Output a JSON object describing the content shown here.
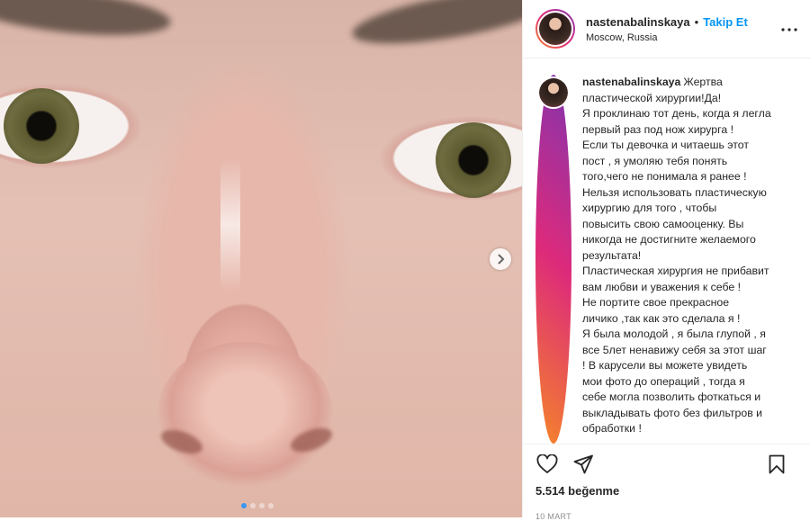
{
  "media": {
    "next_icon": "chevron-right-icon",
    "carousel_dots": 4,
    "active_dot": 0
  },
  "header": {
    "username": "nastenabalinskaya",
    "bullet": "•",
    "follow_label": "Takip Et",
    "location": "Moscow, Russia",
    "more_icon": "ellipsis-icon"
  },
  "caption": {
    "username": "nastenabalinskaya",
    "lines": [
      "Жертва",
      "пластической хирургии!Да!",
      "Я проклинаю тот день, когда я легла",
      "первый раз под нож хирурга !",
      "Если ты девочка и читаешь этот",
      "пост , я умоляю тебя понять",
      "того,чего не понимала я ранее !",
      "Нельзя использовать пластическую",
      "хирургию для того , чтобы",
      "повысить свою самооценку. Вы",
      "никогда не достигните желаемого",
      "результата!",
      "Пластическая хирургия не прибавит",
      "вам любви и уважения к себе !",
      "Не портите свое прекрасное",
      "личико ,так как это сделала я !",
      "Я была молодой , я была глупой , я",
      "все 5лет ненавижу себя за этот шаг",
      "! В карусели вы можете увидеть",
      "мои фото до операций , тогда я",
      "себе могла позволить фоткаться и",
      "выкладывать фото без фильтров и",
      "обработки !"
    ]
  },
  "actions": {
    "like_icon": "heart-icon",
    "share_icon": "paper-plane-icon",
    "save_icon": "bookmark-icon",
    "likes_text": "5.514 beğenme",
    "date_text": "10 MART"
  }
}
